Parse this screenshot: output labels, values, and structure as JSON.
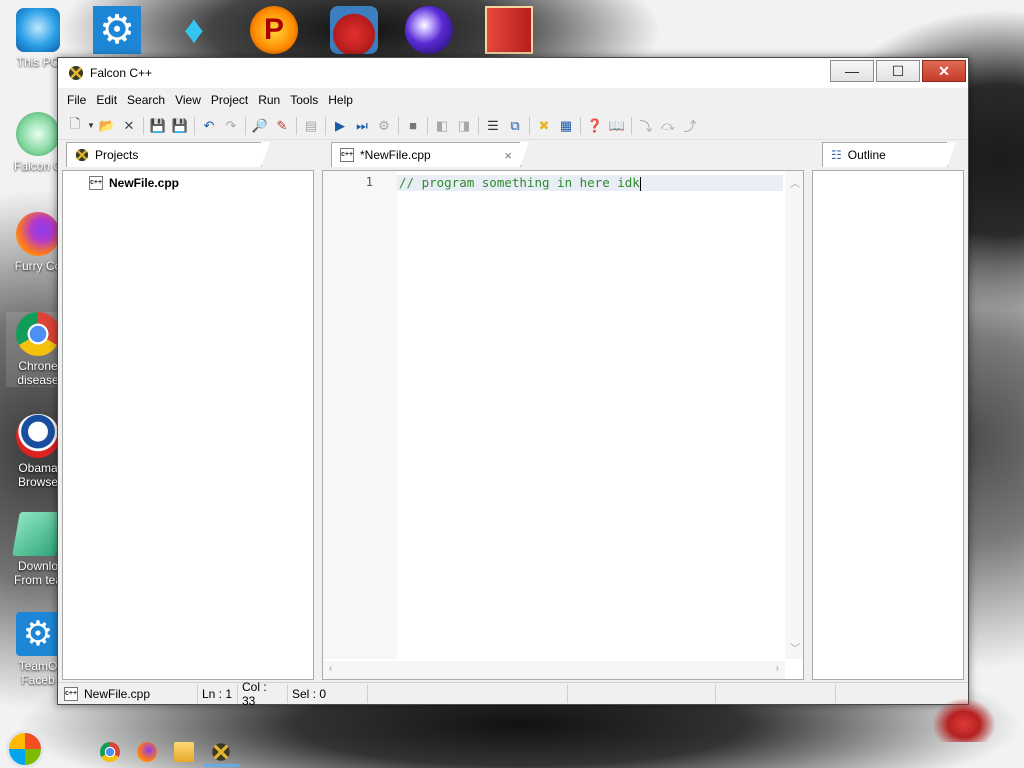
{
  "desktop": {
    "icons": [
      {
        "label": "This PC",
        "name": "this-pc-icon"
      },
      {
        "label": "Falcon C",
        "name": "falcon-shortcut-icon"
      },
      {
        "label": "Furry Co",
        "name": "firefox-shortcut-icon"
      },
      {
        "label": "Chrone\ndisease",
        "name": "chrome-shortcut-icon"
      },
      {
        "label": "Obama\nBrowse",
        "name": "obama-browser-icon"
      },
      {
        "label": "Downlo\nFrom tea",
        "name": "download-shortcut-icon"
      },
      {
        "label": "TeamO\nFaceb",
        "name": "teamo-settings-icon"
      }
    ],
    "top_icons": [
      "settings-gear-icon",
      "diamond-icon",
      "popcorn-p-icon",
      "angry-bird-icon",
      "purple-ball-icon",
      "red-door-icon"
    ]
  },
  "window": {
    "title": "Falcon C++",
    "caption_buttons": {
      "minimize": "—",
      "maximize": "☐",
      "close": "✕"
    }
  },
  "menu": [
    "File",
    "Edit",
    "Search",
    "View",
    "Project",
    "Run",
    "Tools",
    "Help"
  ],
  "toolbar": {
    "buttons": [
      "new-file",
      "open-folder",
      "close",
      "save",
      "save-all",
      "undo",
      "redo",
      "find",
      "replace",
      "print",
      "run",
      "step-run",
      "build",
      "stop",
      "back",
      "forward",
      "list",
      "goto",
      "compile",
      "properties",
      "help",
      "book",
      "step-into",
      "step-over",
      "step-out"
    ]
  },
  "projects_panel": {
    "tab_label": "Projects",
    "items": [
      {
        "label": "NewFile.cpp",
        "type_badge": "c++"
      }
    ]
  },
  "editor": {
    "tab_label": "*NewFile.cpp",
    "tab_close": "×",
    "lines": [
      {
        "number": "1",
        "text": "// program something in here idk"
      }
    ]
  },
  "outline_panel": {
    "tab_label": "Outline"
  },
  "statusbar": {
    "file": "NewFile.cpp",
    "line": "Ln : 1",
    "col": "Col : 33",
    "sel": "Sel : 0"
  },
  "colors": {
    "code_comment": "#2e8b2e",
    "close_button": "#c43d28",
    "current_line": "#e9edf5"
  }
}
